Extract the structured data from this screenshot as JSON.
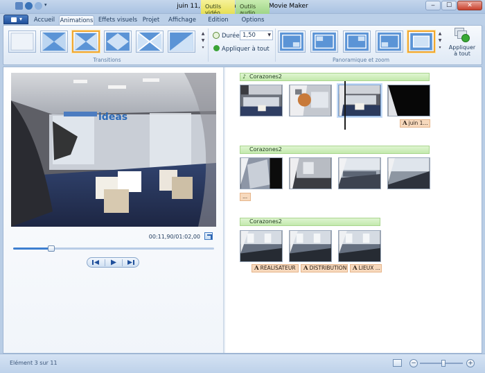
{
  "window": {
    "title": "juin 11, 2009 - Windows Live Movie Maker",
    "context_tabs": [
      {
        "label": "Outils vidéo",
        "color": "#ebe46a"
      },
      {
        "label": "Outils audio",
        "color": "#b2dd99"
      }
    ],
    "buttons": {
      "minimize": "‒",
      "maximize": "☐",
      "close": "✕"
    }
  },
  "ribbon_tabs": [
    "Accueil",
    "Animations",
    "Effets visuels",
    "Projet",
    "Affichage",
    "Edition",
    "Options"
  ],
  "active_tab": "Animations",
  "ribbon": {
    "transitions_label": "Transitions",
    "panzoom_label": "Panoramique et zoom",
    "duration_label": "Durée :",
    "duration_value": "1,50",
    "apply_all_small": "Appliquer à tout",
    "apply_all_big_line1": "Appliquer",
    "apply_all_big_line2": "à tout"
  },
  "preview": {
    "time": "00:11,90/01:02,00",
    "sign_text": "ideas",
    "progress": 0.19
  },
  "storyboard": {
    "groups": [
      {
        "title": "Corazones2",
        "captions": [
          "juin 1..."
        ]
      },
      {
        "title": "Corazones2",
        "captions": [
          "..."
        ]
      },
      {
        "title": "Corazones2",
        "captions": [
          "RÉALISATEUR",
          "DISTRIBUTION",
          "LIEUX ..."
        ]
      }
    ]
  },
  "status": {
    "text": "Elément 3 sur 11",
    "zoom_level": 0.55
  },
  "colors": {
    "accent": "#f0a730",
    "clip_bar": "#c3e9ad",
    "caption": "#f7d9bd"
  }
}
